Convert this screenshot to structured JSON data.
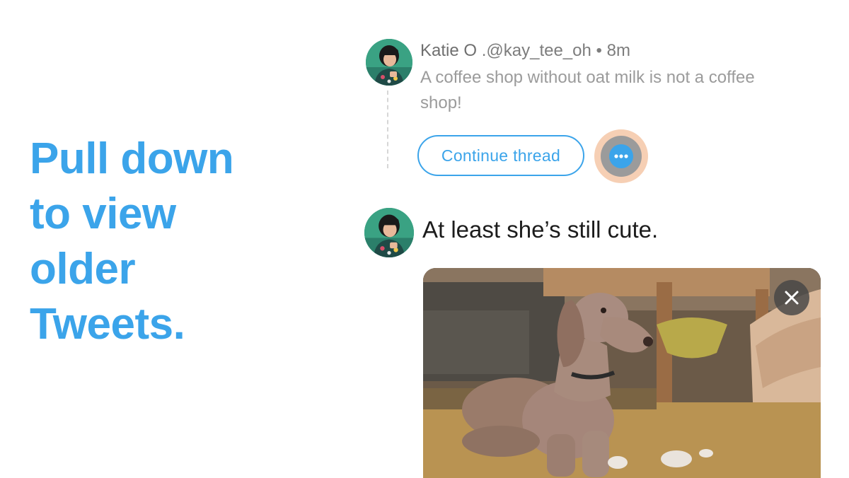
{
  "headline": {
    "line1": "Pull down",
    "line2": "to view",
    "line3": "older",
    "line4": "Tweets."
  },
  "previous_tweet": {
    "display_name": "Katie O",
    "handle": ".@kay_tee_oh",
    "separator": "•",
    "time": "8m",
    "text": "A coffee shop without oat milk is not a coffee shop!",
    "avatar_icon": "user-avatar"
  },
  "thread": {
    "continue_label": "Continue thread",
    "more_icon": "more-dots-icon"
  },
  "composer": {
    "text": "At least she’s still cute.",
    "avatar_icon": "user-avatar",
    "media_description_icon": "dog-photo",
    "close_icon": "close-icon"
  },
  "colors": {
    "accent": "#3ba4ea",
    "muted_text": "#9b9b9b",
    "highlight_ring": "#f6cfb4"
  }
}
